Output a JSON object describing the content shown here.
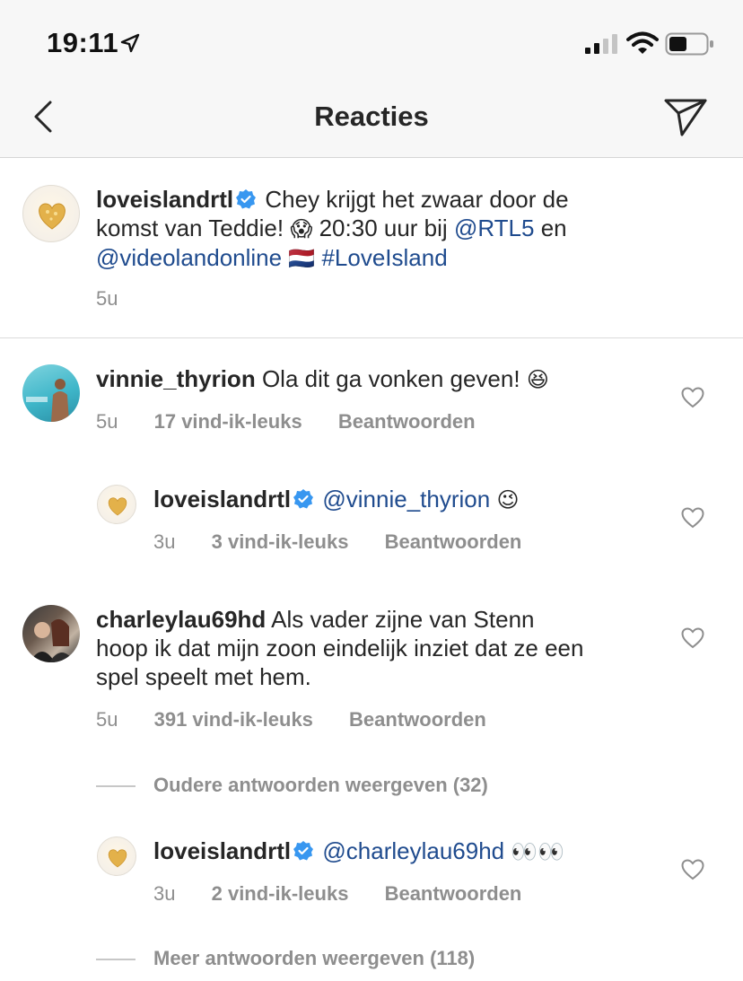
{
  "status_bar": {
    "time": "19:11"
  },
  "header": {
    "title": "Reacties"
  },
  "caption": {
    "username": "loveislandrtl",
    "text_1": "Chey krijgt het zwaar door de",
    "text_2": "komst van Teddie!",
    "emoji_scream": "😱",
    "text_3": "20:30 uur bij",
    "mention_1": "@RTL5",
    "text_4": "en",
    "mention_2": "@videolandonline",
    "flag": "🇳🇱",
    "hashtag": "#LoveIsland",
    "age": "5u"
  },
  "comments": [
    {
      "username": "vinnie_thyrion",
      "text": "Ola dit ga vonken geven!",
      "emoji": "😆",
      "age": "5u",
      "likes": "17 vind-ik-leuks",
      "reply": "Beantwoorden"
    },
    {
      "username": "loveislandrtl",
      "mention": "@vinnie_thyrion",
      "emoji": "😉",
      "age": "3u",
      "likes": "3 vind-ik-leuks",
      "reply": "Beantwoorden"
    },
    {
      "username": "charleylau69hd",
      "text_1": "Als vader zijne van Stenn",
      "text_2": "hoop ik dat mijn zoon eindelijk inziet dat ze een",
      "text_3": "spel speelt met hem.",
      "age": "5u",
      "likes": "391 vind-ik-leuks",
      "reply": "Beantwoorden"
    },
    {
      "username": "loveislandrtl",
      "mention": "@charleylau69hd",
      "emoji": "👀👀",
      "age": "3u",
      "likes": "2 vind-ik-leuks",
      "reply": "Beantwoorden"
    }
  ],
  "view_older": "Oudere antwoorden weergeven (32)",
  "view_more": "Meer antwoorden weergeven (118)",
  "colors": {
    "mention": "#1f4b8e",
    "meta": "#8e8e8e",
    "verified": "#3897f0"
  }
}
